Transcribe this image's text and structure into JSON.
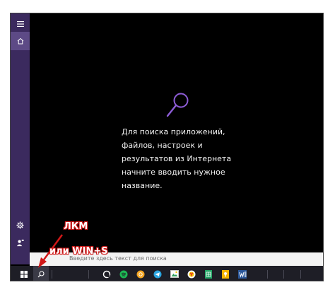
{
  "sidebar": {
    "items": [
      {
        "icon": "hamburger-icon"
      },
      {
        "icon": "home-icon"
      },
      {
        "icon": "gear-icon"
      },
      {
        "icon": "user-feedback-icon"
      }
    ]
  },
  "main": {
    "hint_text": "Для поиска приложений,\nфайлов, настроек и\nрезультатов из Интернета\nначните вводить нужное\nназвание."
  },
  "search_box": {
    "placeholder": "Введите здесь текст для поиска"
  },
  "taskbar": {
    "icons": [
      "windows-start-icon",
      "search-icon",
      "cortana-icon",
      "spotify-icon",
      "media-player-icon",
      "telegram-icon",
      "photos-icon",
      "yandex-browser-icon",
      "sheets-icon",
      "notes-icon",
      "word-icon"
    ]
  },
  "annotation": {
    "line1": "ЛКМ",
    "line2": "или WIN+S",
    "color": "#d11818"
  },
  "colors": {
    "accent": "#8d5cd6",
    "sidebar": "#3b2a5e"
  }
}
